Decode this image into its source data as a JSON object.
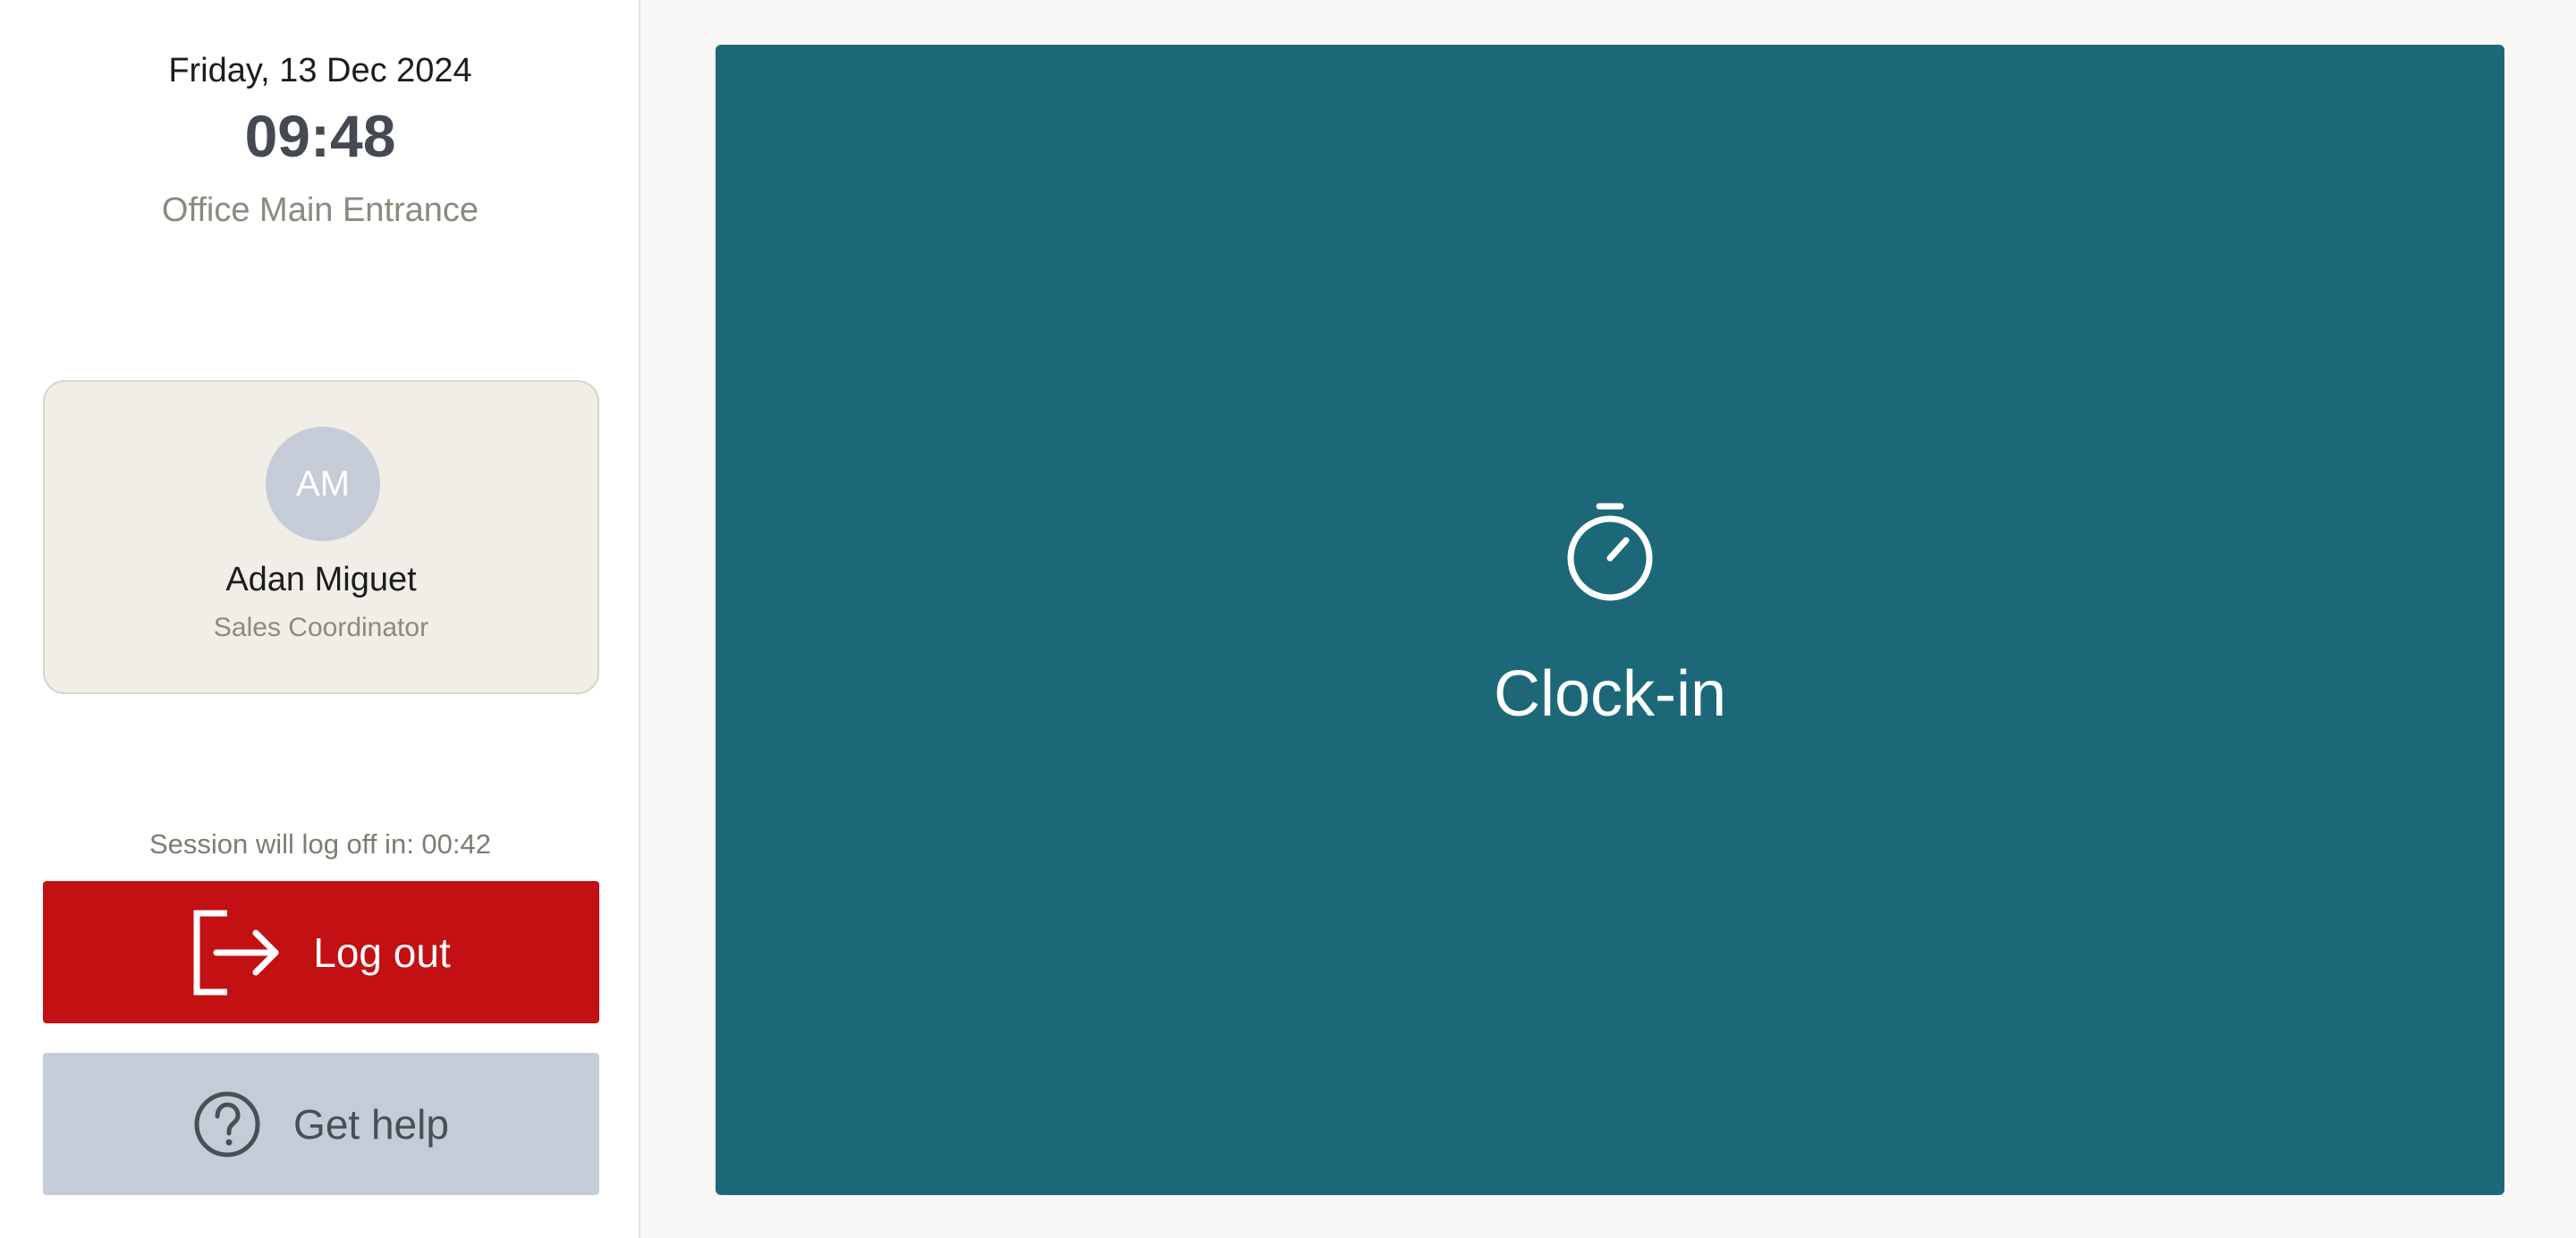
{
  "header": {
    "date": "Friday, 13 Dec 2024",
    "time": "09:48",
    "location": "Office Main Entrance"
  },
  "profile": {
    "initials": "AM",
    "name": "Adan Miguet",
    "role": "Sales Coordinator"
  },
  "session": {
    "countdown_text": "Session will log off in: 00:42"
  },
  "actions": {
    "logout_label": "Log out",
    "logout_icon": "logout-icon",
    "help_label": "Get help",
    "help_icon": "help-circle-icon"
  },
  "main": {
    "clock_label": "Clock-in",
    "clock_icon": "stopwatch-icon"
  },
  "colors": {
    "logout_bg": "#c31013",
    "help_bg": "#c4ccd7",
    "clock_bg": "#1d6878",
    "card_bg": "#f1eee8",
    "avatar_bg": "#c5ccd8"
  }
}
